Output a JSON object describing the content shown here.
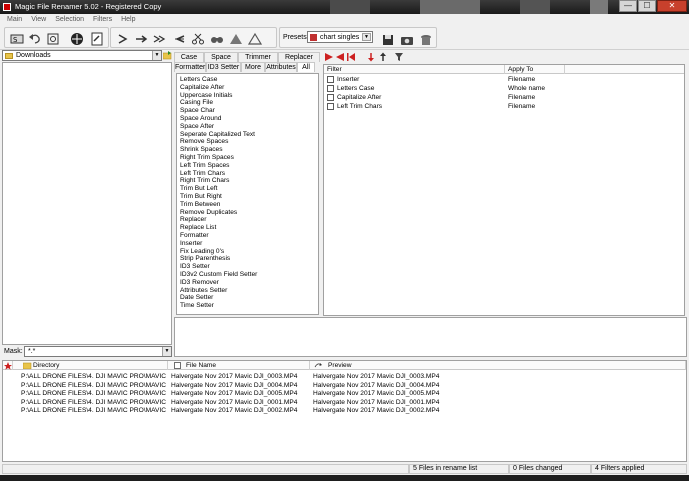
{
  "window": {
    "title": "Magic File Renamer 5.02 - Registered Copy",
    "minimize": "—",
    "maximize": "☐",
    "close": "✕"
  },
  "menu": [
    "Main",
    "View",
    "Selection",
    "Filters",
    "Help"
  ],
  "toolbar": {
    "presets_label": "Presets:",
    "presets_value": "chart singles",
    "icons": [
      "rename-icon",
      "undo-icon",
      "refresh-icon",
      "stop-icon",
      "properties-icon",
      "goto-icon",
      "arrow-right-icon",
      "double-arrow-icon",
      "arrow-left-icon",
      "scissors-icon",
      "binoculars-icon",
      "triangle-icon",
      "triangle-outline-icon",
      "save-icon",
      "camera-icon",
      "delete-icon"
    ]
  },
  "left_panel": {
    "folder": "Downloads",
    "mask_label": "Mask:",
    "mask_value": "*.*"
  },
  "filter_tabs": {
    "row1": [
      "Case",
      "Space",
      "Trimmer",
      "Replacer"
    ],
    "row2": [
      "Formatter",
      "ID3 Setter",
      "More",
      "Attributes",
      "All"
    ]
  },
  "filters_list": [
    "Letters Case",
    "Capitalize After",
    "Uppercase Initials",
    "Casing File",
    "Space Char",
    "Space Around",
    "Space After",
    "Seperate Capitalized Text",
    "Remove Spaces",
    "Shrink Spaces",
    "Right Trim Spaces",
    "Left Trim Spaces",
    "Left Trim Chars",
    "Right Trim Chars",
    "Trim But Left",
    "Trim But Right",
    "Trim Between",
    "Remove Duplicates",
    "Replacer",
    "Replace List",
    "Formatter",
    "Inserter",
    "Fix Leading 0's",
    "Strip Parenthesis",
    "ID3 Setter",
    "ID3v2 Custom Field Setter",
    "ID3 Remover",
    "Attributes Setter",
    "Date Setter",
    "Time Setter"
  ],
  "active_filters": {
    "col_filter": "Filter",
    "col_apply": "Apply To",
    "rows": [
      {
        "name": "Inserter",
        "apply": "Filename"
      },
      {
        "name": "Letters Case",
        "apply": "Whole name"
      },
      {
        "name": "Capitalize After",
        "apply": "Filename"
      },
      {
        "name": "Left Trim Chars",
        "apply": "Filename"
      }
    ]
  },
  "file_list": {
    "col_directory": "Directory",
    "col_filename": "File Name",
    "col_preview": "Preview",
    "rows": [
      {
        "dir": "P:\\ALL DRONE FILES\\4. DJI MAVIC PRO\\MAVIC ...",
        "name": "Halvergate Nov 2017  Mavic DJI_0003.MP4",
        "preview": "Halvergate Nov 2017  Mavic DJI_0003.MP4"
      },
      {
        "dir": "P:\\ALL DRONE FILES\\4. DJI MAVIC PRO\\MAVIC ...",
        "name": "Halvergate Nov 2017  Mavic DJI_0004.MP4",
        "preview": "Halvergate Nov 2017  Mavic DJI_0004.MP4"
      },
      {
        "dir": "P:\\ALL DRONE FILES\\4. DJI MAVIC PRO\\MAVIC ...",
        "name": "Halvergate Nov 2017  Mavic DJI_0005.MP4",
        "preview": "Halvergate Nov 2017  Mavic DJI_0005.MP4"
      },
      {
        "dir": "P:\\ALL DRONE FILES\\4. DJI MAVIC PRO\\MAVIC ...",
        "name": "Halvergate Nov 2017  Mavic DJI_0001.MP4",
        "preview": "Halvergate Nov 2017  Mavic DJI_0001.MP4"
      },
      {
        "dir": "P:\\ALL DRONE FILES\\4. DJI MAVIC PRO\\MAVIC ...",
        "name": "Halvergate Nov 2017  Mavic DJI_0002.MP4",
        "preview": "Halvergate Nov 2017  Mavic DJI_0002.MP4"
      }
    ]
  },
  "status": {
    "files_in_list": "5 Files in rename list",
    "files_changed": "0 Files changed",
    "filters_applied": "4 Filters applied"
  },
  "colors": {
    "accent_red": "#cc2020",
    "folder_yellow": "#e8c44a"
  }
}
